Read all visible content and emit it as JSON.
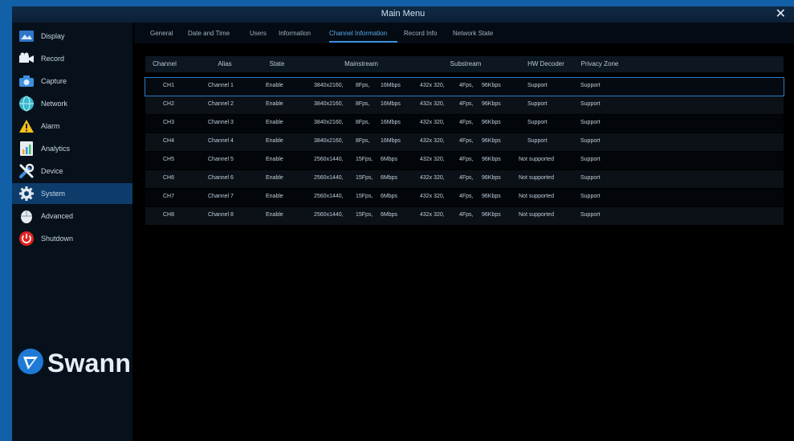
{
  "window": {
    "title": "Main Menu",
    "close_symbol": "✕"
  },
  "sidebar": {
    "items": [
      {
        "label": "Display",
        "icon": "display-icon"
      },
      {
        "label": "Record",
        "icon": "record-icon"
      },
      {
        "label": "Capture",
        "icon": "capture-icon"
      },
      {
        "label": "Network",
        "icon": "network-icon"
      },
      {
        "label": "Alarm",
        "icon": "alarm-icon"
      },
      {
        "label": "Analytics",
        "icon": "analytics-icon"
      },
      {
        "label": "Device",
        "icon": "device-icon"
      },
      {
        "label": "System",
        "icon": "system-icon"
      },
      {
        "label": "Advanced",
        "icon": "advanced-icon"
      },
      {
        "label": "Shutdown",
        "icon": "shutdown-icon"
      }
    ],
    "active_index": 7,
    "logo_text": "Swann"
  },
  "tabs": {
    "items": [
      "General",
      "Date and Time",
      "Users",
      "Information",
      "Channel Information",
      "Record Info",
      "Network State"
    ],
    "active_index": 4
  },
  "table": {
    "headers": [
      "Channel",
      "Alias",
      "State",
      "Mainstream",
      "Substream",
      "HW Decoder",
      "Privacy Zone"
    ],
    "rows": [
      [
        "CH1",
        "Channel 1",
        "Enable",
        "3840x2160,",
        "8Fps,",
        "16Mbps",
        "432x 320,",
        "4Fps,",
        "96Kbps",
        "Support",
        "Support"
      ],
      [
        "CH2",
        "Channel 2",
        "Enable",
        "3840x2160,",
        "8Fps,",
        "16Mbps",
        "432x 320,",
        "4Fps,",
        "96Kbps",
        "Support",
        "Support"
      ],
      [
        "CH3",
        "Channel 3",
        "Enable",
        "3840x2160,",
        "8Fps,",
        "16Mbps",
        "432x 320,",
        "4Fps,",
        "96Kbps",
        "Support",
        "Support"
      ],
      [
        "CH4",
        "Channel 4",
        "Enable",
        "3840x2160,",
        "8Fps,",
        "16Mbps",
        "432x 320,",
        "4Fps,",
        "96Kbps",
        "Support",
        "Support"
      ],
      [
        "CH5",
        "Channel 5",
        "Enable",
        "2560x1440,",
        "15Fps,",
        "6Mbps",
        "432x 320,",
        "4Fps,",
        "96Kbps",
        "Not supported",
        "Support"
      ],
      [
        "CH6",
        "Channel 6",
        "Enable",
        "2560x1440,",
        "15Fps,",
        "6Mbps",
        "432x 320,",
        "4Fps,",
        "96Kbps",
        "Not supported",
        "Support"
      ],
      [
        "CH7",
        "Channel 7",
        "Enable",
        "2560x1440,",
        "15Fps,",
        "6Mbps",
        "432x 320,",
        "4Fps,",
        "96Kbps",
        "Not supported",
        "Support"
      ],
      [
        "CH8",
        "Channel 8",
        "Enable",
        "2560x1440,",
        "15Fps,",
        "6Mbps",
        "432x 320,",
        "4Fps,",
        "96Kbps",
        "Not supported",
        "Support"
      ]
    ],
    "selected_index": 0
  },
  "colors": {
    "accent": "#3d8fdb",
    "frame_blue": "#1160a8",
    "active_nav": "#0d3c6b"
  }
}
